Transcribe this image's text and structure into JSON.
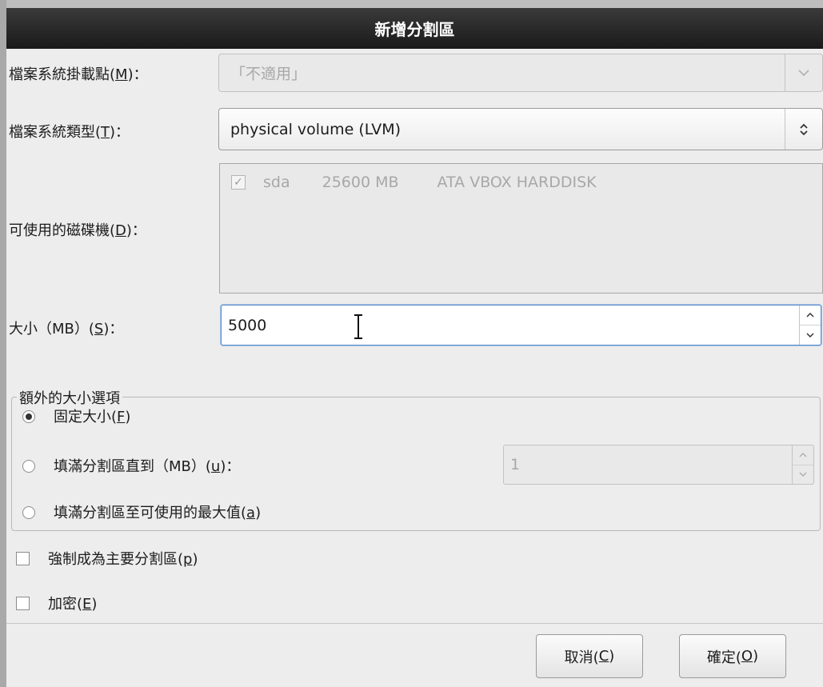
{
  "dialog": {
    "title": "新增分割區"
  },
  "mount_point": {
    "label": "檔案系統掛載點(",
    "mnemonic": "M",
    "label_end": ")：",
    "value": "「不適用」",
    "disabled": true
  },
  "fs_type": {
    "label": "檔案系統類型(",
    "mnemonic": "T",
    "label_end": ")：",
    "value": "physical volume (LVM)"
  },
  "drives": {
    "label": "可使用的磁碟機(",
    "mnemonic": "D",
    "label_end": ")：",
    "items": [
      {
        "checked": true,
        "name": "sda",
        "size": "25600 MB",
        "model": "ATA VBOX HARDDISK"
      }
    ]
  },
  "size": {
    "label": "大小（MB）(",
    "mnemonic": "S",
    "label_end": ")：",
    "value": "5000"
  },
  "size_options": {
    "legend": "額外的大小選項",
    "fixed": {
      "label": "固定大小(",
      "mnemonic": "F",
      "label_end": ")",
      "selected": true
    },
    "fill_to": {
      "label": "填滿分割區直到（MB）(",
      "mnemonic": "u",
      "label_end": ")：",
      "selected": false,
      "value": "1"
    },
    "fill_max": {
      "label": "填滿分割區至可使用的最大值(",
      "mnemonic": "a",
      "label_end": ")",
      "selected": false
    }
  },
  "force_primary": {
    "label": "強制成為主要分割區(",
    "mnemonic": "p",
    "label_end": ")",
    "checked": false
  },
  "encrypt": {
    "label": "加密(",
    "mnemonic": "E",
    "label_end": ")",
    "checked": false
  },
  "buttons": {
    "cancel": {
      "label": "取消(",
      "mnemonic": "C",
      "label_end": ")"
    },
    "ok": {
      "label": "確定(",
      "mnemonic": "O",
      "label_end": ")"
    }
  }
}
